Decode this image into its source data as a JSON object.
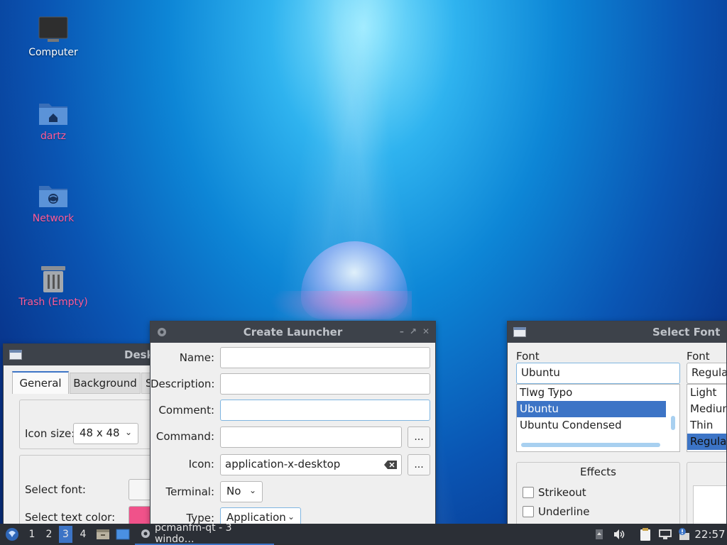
{
  "desktop": {
    "icons": [
      {
        "label": "Computer",
        "icon": "computer-icon"
      },
      {
        "label": "dartz",
        "icon": "home-folder-icon"
      },
      {
        "label": "Network",
        "icon": "network-folder-icon"
      },
      {
        "label": "Trash (Empty)",
        "icon": "trash-icon"
      }
    ]
  },
  "desktop_prefs": {
    "title": "Desk",
    "tabs": [
      "General",
      "Background",
      "S"
    ],
    "icon_size_label": "Icon size:",
    "icon_size_value": "48 x 48",
    "select_font_label": "Select font:",
    "select_text_color_label": "Select text color:",
    "text_color": "#f0528a"
  },
  "create_launcher": {
    "title": "Create Launcher",
    "name_label": "Name:",
    "description_label": "Description:",
    "comment_label": "Comment:",
    "command_label": "Command:",
    "browse_label": "...",
    "icon_label": "Icon:",
    "icon_value": "application-x-desktop",
    "terminal_label": "Terminal:",
    "terminal_value": "No",
    "type_label": "Type:",
    "type_value": "Application",
    "name_value": "",
    "description_value": "",
    "comment_value": "",
    "command_value": ""
  },
  "select_font": {
    "title": "Select Font",
    "font_label": "Font",
    "font_value": "Ubuntu",
    "font_list": [
      "Tlwg Typo",
      "Ubuntu",
      "Ubuntu Condensed"
    ],
    "selected_font": "Ubuntu",
    "style_label": "Font styl",
    "style_value": "Regular",
    "style_list": [
      "Light",
      "Medium",
      "Thin",
      "Regular"
    ],
    "selected_style": "Regular",
    "effects_label": "Effects",
    "strikeout_label": "Strikeout",
    "underline_label": "Underline"
  },
  "taskbar": {
    "workspaces": [
      "1",
      "2",
      "3",
      "4"
    ],
    "active_workspace": "3",
    "task_label": "pcmanfm-qt - 3 windo…",
    "clock": "22:57",
    "colors": {
      "bar": "#2b2f36",
      "active": "#3c74c6"
    }
  }
}
